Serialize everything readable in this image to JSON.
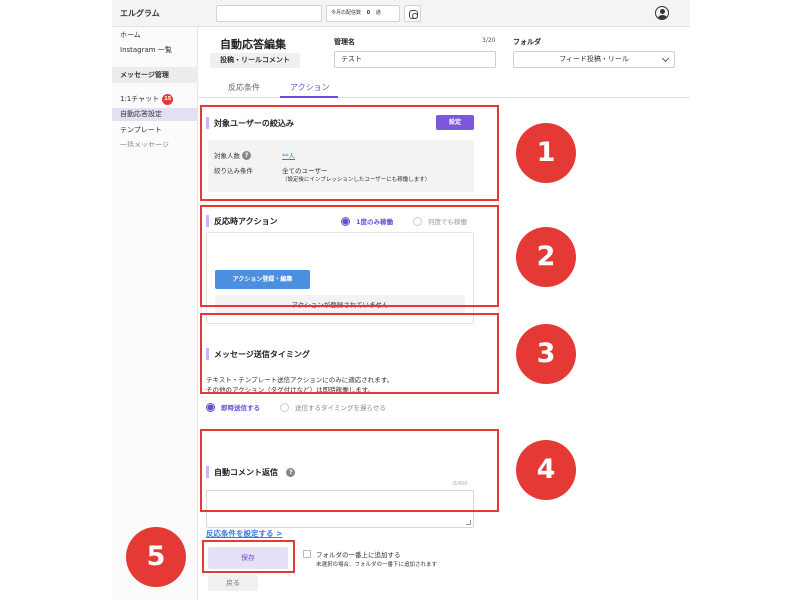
{
  "app": {
    "brand": "エルグラム",
    "quota_label": "今月の配信数",
    "quota_value": "0",
    "quota_unit": "通"
  },
  "sidebar": {
    "items": [
      {
        "label": "ホーム"
      },
      {
        "label": "Instagram 一覧"
      }
    ],
    "section_label": "メッセージ管理",
    "sub_items": [
      {
        "label": "1:1チャット",
        "badge": "15"
      },
      {
        "label": "自動応答設定"
      },
      {
        "label": "テンプレート"
      },
      {
        "label": "一括メッセージ"
      }
    ]
  },
  "header": {
    "title": "自動応答編集",
    "subtitle": "投稿・リールコメント",
    "name_label": "管理名",
    "name_counter": "3/20",
    "name_value": "テスト",
    "folder_label": "フォルダ",
    "folder_value": "フィード投稿・リール"
  },
  "tabs": [
    {
      "label": "反応条件"
    },
    {
      "label": "アクション"
    }
  ],
  "section1": {
    "title": "対象ユーザーの絞込み",
    "button": "設定",
    "count_label": "対象人数",
    "count_value": "**人",
    "filter_label": "絞り込み条件",
    "filter_value": "全てのユーザー",
    "filter_note": "（設定後にインプレッションしたユーザーにも稼働します）"
  },
  "section2": {
    "title": "反応時アクション",
    "radio_once": "1度のみ稼働",
    "radio_many": "何度でも稼働",
    "button": "アクション登録・編集",
    "empty_text": "アクションが登録されていません"
  },
  "section3": {
    "title": "メッセージ送信タイミング",
    "desc1": "テキスト・テンプレート送信アクションにのみに適応されます。",
    "desc2": "その他のアクション（タグ付けなど）は即時稼働します。",
    "radio_now": "即時送信する",
    "radio_delay": "送信するタイミングを遅らせる"
  },
  "section4": {
    "title": "自動コメント返信",
    "counter": "0/400"
  },
  "footer": {
    "link": "反応条件を設定する >",
    "save": "保存",
    "folder_top_label": "フォルダの一番上に追加する",
    "folder_top_note": "未選択の場合、フォルダの一番下に追加されます",
    "back": "戻る"
  },
  "callouts": [
    "1",
    "2",
    "3",
    "4",
    "5"
  ],
  "colors": {
    "accent": "#6a4fd6",
    "highlight": "#e53935",
    "action_button": "#4a8fe0"
  }
}
